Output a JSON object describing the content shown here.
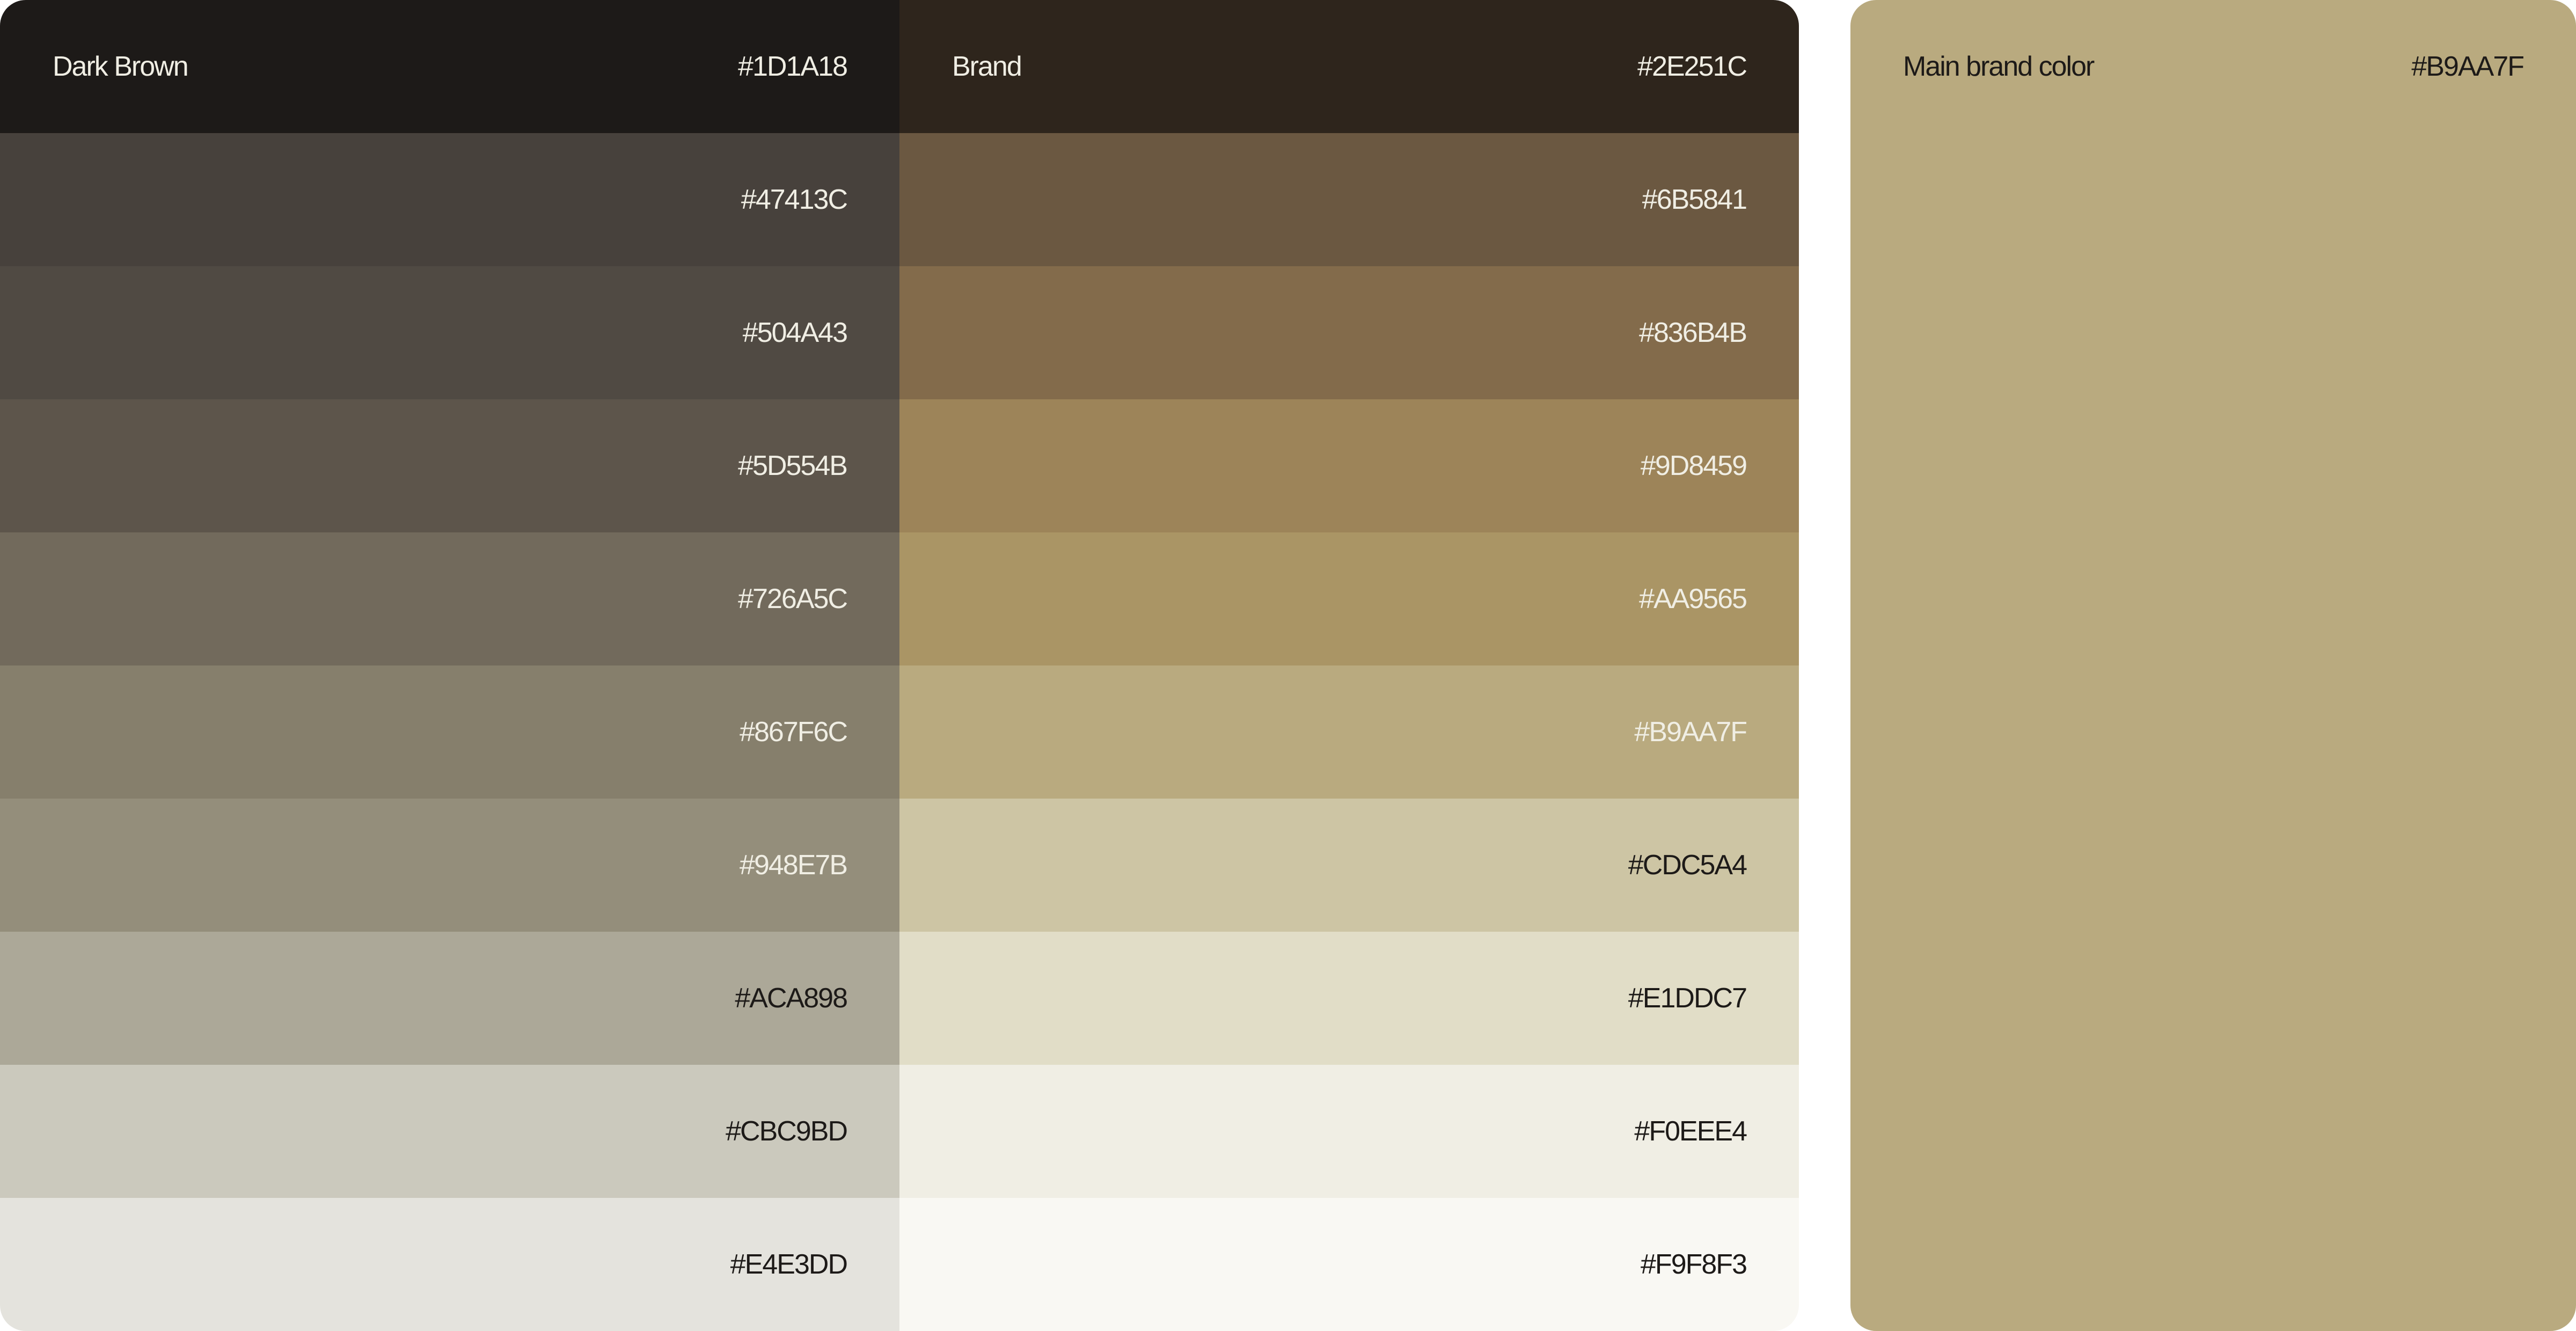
{
  "columns": [
    {
      "id": "dark-brown",
      "name": "Dark Brown",
      "swatches": [
        {
          "hex": "#1D1A18",
          "text_color": "#F0EEE4"
        },
        {
          "hex": "#47413C",
          "text_color": "#F0EEE4"
        },
        {
          "hex": "#504A43",
          "text_color": "#F0EEE4"
        },
        {
          "hex": "#5D554B",
          "text_color": "#F0EEE4"
        },
        {
          "hex": "#726A5C",
          "text_color": "#F0EEE4"
        },
        {
          "hex": "#867F6C",
          "text_color": "#F0EEE4"
        },
        {
          "hex": "#948E7B",
          "text_color": "#F0EEE4"
        },
        {
          "hex": "#ACA898",
          "text_color": "#1D1A18"
        },
        {
          "hex": "#CBC9BD",
          "text_color": "#1D1A18"
        },
        {
          "hex": "#E4E3DD",
          "text_color": "#1D1A18"
        }
      ]
    },
    {
      "id": "brand",
      "name": "Brand",
      "swatches": [
        {
          "hex": "#2E251C",
          "text_color": "#F0EEE4"
        },
        {
          "hex": "#6B5841",
          "text_color": "#F0EEE4"
        },
        {
          "hex": "#836B4B",
          "text_color": "#F0EEE4"
        },
        {
          "hex": "#9D8459",
          "text_color": "#F0EEE4"
        },
        {
          "hex": "#AA9565",
          "text_color": "#F0EEE4"
        },
        {
          "hex": "#B9AA7F",
          "text_color": "#F0EEE4"
        },
        {
          "hex": "#CDC5A4",
          "text_color": "#1D1A18"
        },
        {
          "hex": "#E1DDC7",
          "text_color": "#1D1A18"
        },
        {
          "hex": "#F0EEE4",
          "text_color": "#1D1A18"
        },
        {
          "hex": "#F9F8F3",
          "text_color": "#1D1A18"
        }
      ]
    }
  ],
  "main_brand": {
    "label": "Main brand color",
    "hex": "#B9AA7F",
    "text_color": "#1D1A18"
  }
}
